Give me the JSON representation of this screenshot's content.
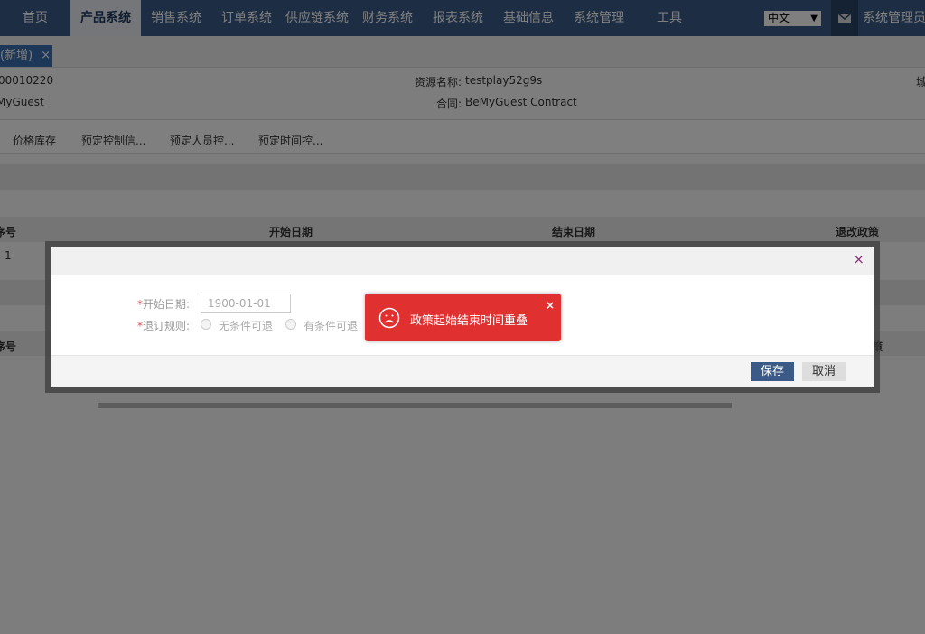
{
  "nav": {
    "items": [
      "首页",
      "产品系统",
      "销售系统",
      "订单系统",
      "供应链系统",
      "财务系统",
      "报表系统",
      "基础信息",
      "系统管理",
      "工具"
    ],
    "active_index": 1,
    "language": "中文",
    "user": "系统管理员"
  },
  "tab": {
    "label": "(新增)",
    "close": "×"
  },
  "info": {
    "code": "00010220",
    "resource_name_label": "资源名称:",
    "resource_name_value": "testplay52g9s",
    "supplier": "MyGuest",
    "contract_label": "合同:",
    "contract_value": "BeMyGuest Contract",
    "right_edge_char": "城"
  },
  "subtabs": [
    "价格库存",
    "预定控制信...",
    "预定人员控...",
    "预定时间控..."
  ],
  "table1": {
    "headers": [
      "序号",
      "开始日期",
      "结束日期",
      "退改政策"
    ],
    "rows": [
      [
        "1"
      ]
    ]
  },
  "table2": {
    "headers": [
      "序号",
      "策"
    ]
  },
  "modal": {
    "close": "×",
    "start_date_label": "开始日期:",
    "start_date_value": "1900-01-01",
    "refund_rule_label": "退订规则:",
    "options": [
      "无条件可退",
      "有条件可退"
    ],
    "required_mark": "*",
    "save": "保存",
    "cancel": "取消"
  },
  "toast": {
    "message": "政策起始结束时间重叠",
    "close": "×"
  },
  "colors": {
    "nav_bg": "#3b5b86",
    "toast_bg": "#e03030",
    "tab_bg": "#3b6fb0"
  }
}
